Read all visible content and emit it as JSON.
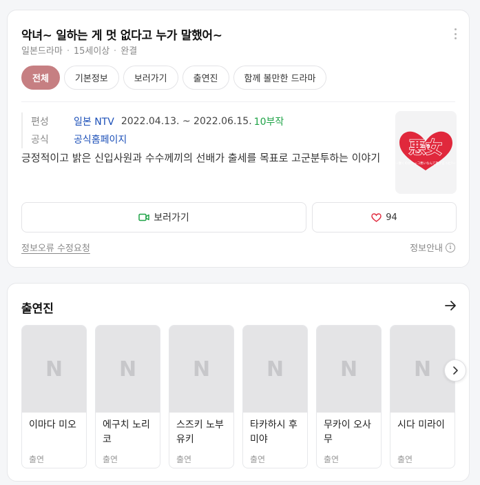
{
  "header": {
    "title": "악녀~ 일하는 게 멋 없다고 누가 말했어~",
    "meta": [
      "일본드라마",
      "15세이상",
      "완결"
    ]
  },
  "tabs": [
    {
      "label": "전체",
      "active": true
    },
    {
      "label": "기본정보",
      "active": false
    },
    {
      "label": "보러가기",
      "active": false
    },
    {
      "label": "출연진",
      "active": false
    },
    {
      "label": "함께 볼만한 드라마",
      "active": false
    }
  ],
  "info": {
    "broadcast_key": "편성",
    "broadcast_channel": "일본 NTV",
    "broadcast_dates": "2022.04.13. ~ 2022.06.15.",
    "episodes": "10부작",
    "official_key": "공식",
    "official_link": "공식홈페이지"
  },
  "synopsis": "긍정적이고 밝은 신입사원과 수수께끼의 선배가 출세를 목표로 고군분투하는 이야기",
  "poster": {
    "logo_text": "悪女",
    "logo_sub": "わる",
    "tagline": "~働くのがカッコ悪いなんて誰が言った?~",
    "accent_color": "#e0283c"
  },
  "actions": {
    "watch_label": "보러가기",
    "like_count": "94",
    "watch_icon_color": "#1fa347",
    "like_icon_color": "#e0283c"
  },
  "footer": {
    "report_label": "정보오류 수정요청",
    "guide_label": "정보안내"
  },
  "cast": {
    "title": "출연진",
    "placeholder_letter": "N",
    "members": [
      {
        "name": "이마다 미오",
        "role": "출연"
      },
      {
        "name": "에구치 노리코",
        "role": "출연"
      },
      {
        "name": "스즈키 노부유키",
        "role": "출연"
      },
      {
        "name": "타카하시 후미야",
        "role": "출연"
      },
      {
        "name": "무카이 오사무",
        "role": "출연"
      },
      {
        "name": "시다 미라이",
        "role": "출연"
      }
    ]
  }
}
